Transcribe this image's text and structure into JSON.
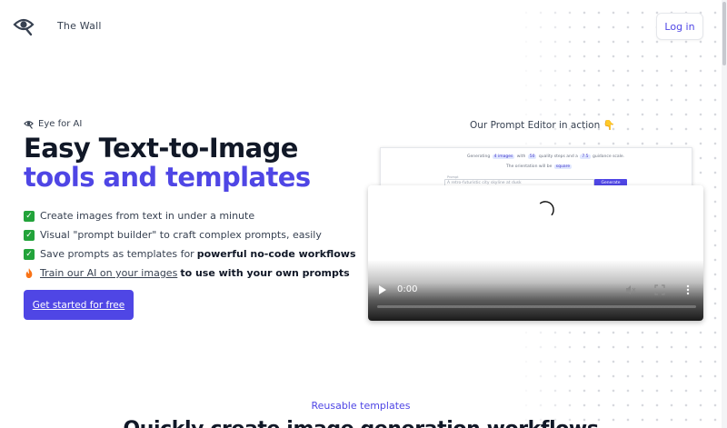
{
  "header": {
    "brand": "The Wall",
    "login_label": "Log in"
  },
  "hero": {
    "eyebrow": "Eye for AI",
    "title_line1": "Easy Text-to-Image",
    "title_line2": "tools and templates",
    "features": [
      {
        "icon": "check-icon",
        "text": "Create images from text in under a minute"
      },
      {
        "icon": "check-icon",
        "text": "Visual \"prompt builder\" to craft complex prompts, easily"
      },
      {
        "icon": "check-icon",
        "text": "Save prompts as templates for",
        "bold": "powerful no-code workflows"
      },
      {
        "icon": "fire-icon",
        "link": "Train our AI on your images",
        "bold": "to use with your own prompts"
      }
    ],
    "cta_label": "Get started for free"
  },
  "editor": {
    "caption": "Our Prompt Editor in action 👇",
    "preview": {
      "line1_a": "Generating",
      "pill1": "4 images",
      "line1_b": "with",
      "pill2": "50",
      "line1_c": "quality steps and a",
      "pill3": "7.5",
      "line1_d": "guidance scale.",
      "line2_a": "The orientation will be",
      "pill4": "square",
      "input_label": "Prompt",
      "input_placeholder": "A retro-futuristic city skyline at dusk",
      "button": "Generate"
    }
  },
  "video": {
    "time": "0:00",
    "progress": 0
  },
  "section": {
    "eyebrow": "Reusable templates",
    "title": "Quickly create image generation workflows"
  },
  "colors": {
    "accent": "#4f46e5",
    "check": "#22a33a",
    "heading": "#111827"
  }
}
